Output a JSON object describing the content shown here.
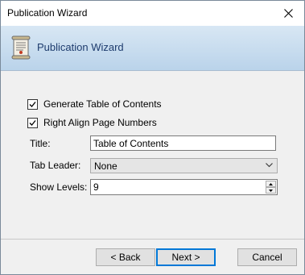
{
  "window": {
    "title": "Publication Wizard"
  },
  "header": {
    "title": "Publication Wizard",
    "icon": "document-scroll-icon"
  },
  "options": {
    "generate_toc": {
      "label": "Generate Table of Contents",
      "checked": true
    },
    "right_align": {
      "label": "Right Align Page Numbers",
      "checked": true
    }
  },
  "fields": {
    "title_label": "Title:",
    "title_value": "Table of Contents",
    "tab_leader_label": "Tab Leader:",
    "tab_leader_value": "None",
    "show_levels_label": "Show Levels:",
    "show_levels_value": "9"
  },
  "buttons": {
    "back": "< Back",
    "next": "Next >",
    "cancel": "Cancel"
  },
  "colors": {
    "accent": "#0078d7",
    "header_gradient_top": "#d8e7f4",
    "header_gradient_bottom": "#bad3ea"
  }
}
